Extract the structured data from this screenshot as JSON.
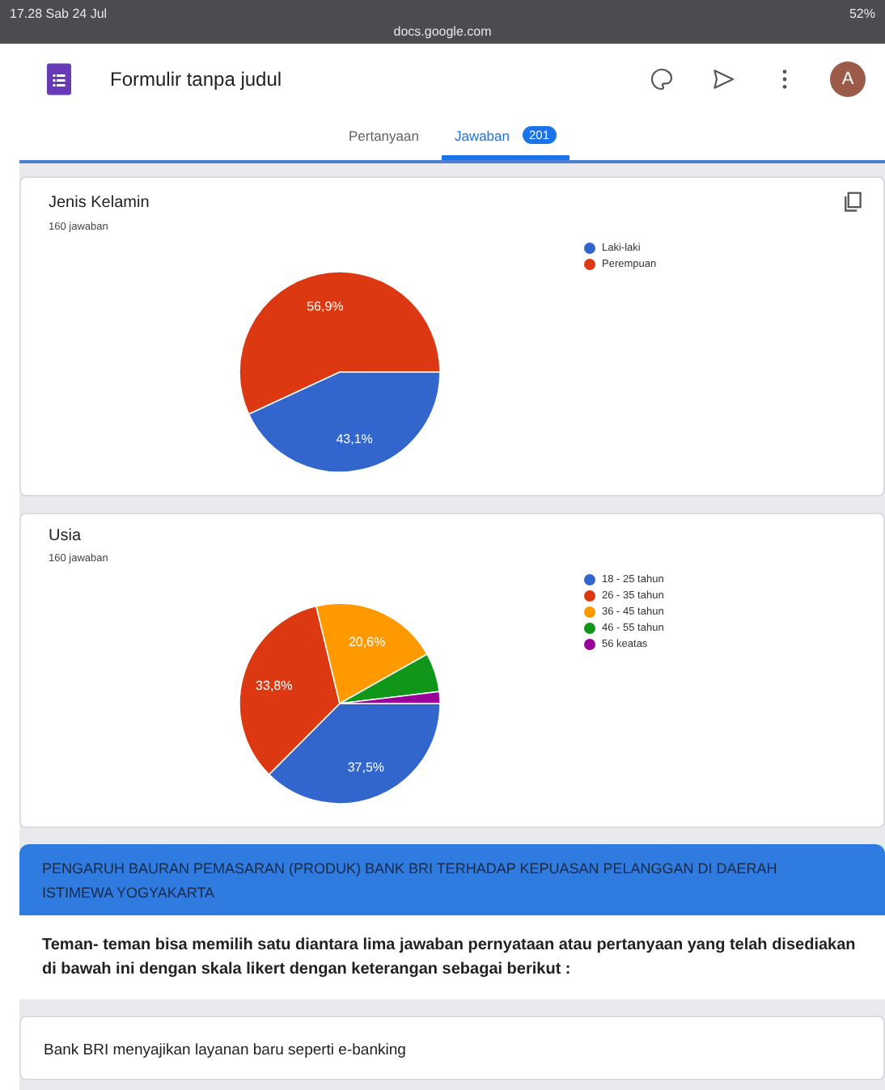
{
  "status_bar": {
    "time": "17.28  Sab 24 Jul",
    "url": "docs.google.com",
    "battery": "52%"
  },
  "header": {
    "title": "Formulir tanpa judul",
    "avatar": "A"
  },
  "tabs": [
    {
      "label": "Pertanyaan",
      "selected": false
    },
    {
      "label": "Jawaban",
      "selected": true,
      "badge": "201"
    }
  ],
  "questions": [
    {
      "title": "Jenis Kelamin",
      "count": "160 jawaban",
      "chart_data": {
        "type": "pie",
        "categories": [
          "Laki-laki",
          "Perempuan"
        ],
        "series": [
          {
            "values": [
              43.1,
              56.9
            ]
          }
        ],
        "legend": "right",
        "colors": [
          "#3366cc",
          "#dc3912"
        ],
        "value_labels": [
          "43,1%",
          "56,9%"
        ]
      }
    },
    {
      "title": "Usia",
      "count": "160 jawaban",
      "chart_data": {
        "type": "pie",
        "categories": [
          "18 - 25 tahun",
          "26 - 35 tahun",
          "36 - 45 tahun",
          "46 - 55 tahun",
          "56 keatas"
        ],
        "series": [
          {
            "values": [
              37.5,
              33.8,
              20.6,
              6.3,
              1.9
            ]
          }
        ],
        "legend": "right",
        "colors": [
          "#3366cc",
          "#dc3912",
          "#ff9900",
          "#109618",
          "#990099"
        ],
        "value_labels": [
          "37,5%",
          "33,8%",
          "20,6%",
          null,
          null
        ]
      }
    }
  ],
  "section": {
    "title": "PENGARUH BAURAN PEMASARAN (PRODUK) BANK BRI TERHADAP KEPUASAN PELANGGAN DI DAERAH ISTIMEWA YOGYAKARTA",
    "description": "Teman- teman bisa memilih satu diantara lima jawaban pernyataan atau pertanyaan yang telah disediakan di bawah ini dengan skala likert dengan keterangan sebagai berikut :"
  },
  "next_question": {
    "title": "Bank BRI menyajikan layanan baru seperti e-banking"
  }
}
